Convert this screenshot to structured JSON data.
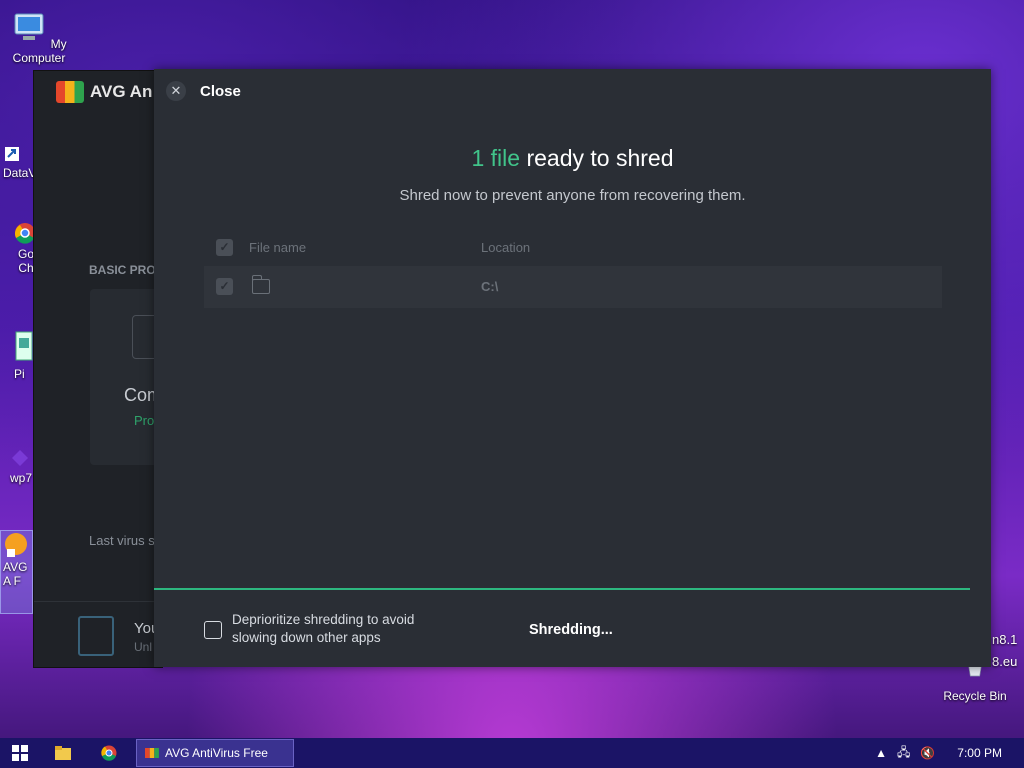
{
  "desktop": {
    "icons": [
      {
        "label": "My Computer"
      },
      {
        "label": "DataV"
      },
      {
        "label": "Go Ch"
      },
      {
        "label": "Pi"
      },
      {
        "label": "wp7"
      },
      {
        "label": "AVG A F"
      },
      {
        "label": "Recycle Bin"
      }
    ],
    "side_text_1": "n8.1",
    "side_text_2": "8.eu"
  },
  "avg_window": {
    "title": "AVG An",
    "section_label": "BASIC PRO",
    "card_title": "Com",
    "card_subtitle": "Pro",
    "last_scan": "Last virus s",
    "footer_title": "You",
    "footer_sub": "Unl"
  },
  "dialog": {
    "close_label": "Close",
    "headline_count": "1 file",
    "headline_rest": " ready to shred",
    "subline": "Shred now to prevent anyone from recovering them.",
    "columns": [
      "File name",
      "Location"
    ],
    "rows": [
      {
        "file_name": "",
        "location": "C:\\"
      }
    ],
    "deprioritize_label": "Deprioritize shredding to avoid slowing down other apps",
    "deprioritize_checked": false,
    "status": "Shredding...",
    "progress": 0.975,
    "accent_color": "#41c48a"
  },
  "taskbar": {
    "active_task": "AVG AntiVirus Free",
    "clock": "7:00 PM"
  }
}
